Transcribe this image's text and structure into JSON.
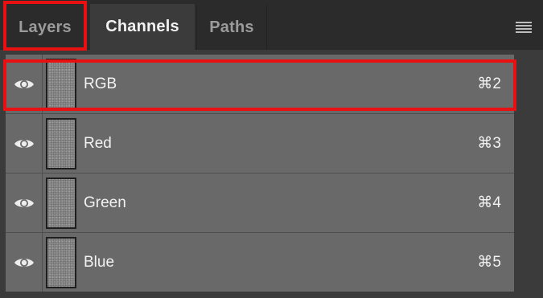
{
  "tabs": [
    {
      "label": "Layers"
    },
    {
      "label": "Channels"
    },
    {
      "label": "Paths"
    }
  ],
  "channels": [
    {
      "name": "RGB",
      "shortcut": "⌘2"
    },
    {
      "name": "Red",
      "shortcut": "⌘3"
    },
    {
      "name": "Green",
      "shortcut": "⌘4"
    },
    {
      "name": "Blue",
      "shortcut": "⌘5"
    }
  ],
  "colors": {
    "highlight": "#e81010",
    "row_background": "#696969",
    "panel_background": "#3b3b3b",
    "tabbar_background": "#2b2b2b"
  },
  "icons": {
    "visibility": "eye-icon",
    "panel_menu": "hamburger-menu-icon",
    "channel_thumbnail": "noise-thumbnail"
  },
  "active_tab": "Channels"
}
